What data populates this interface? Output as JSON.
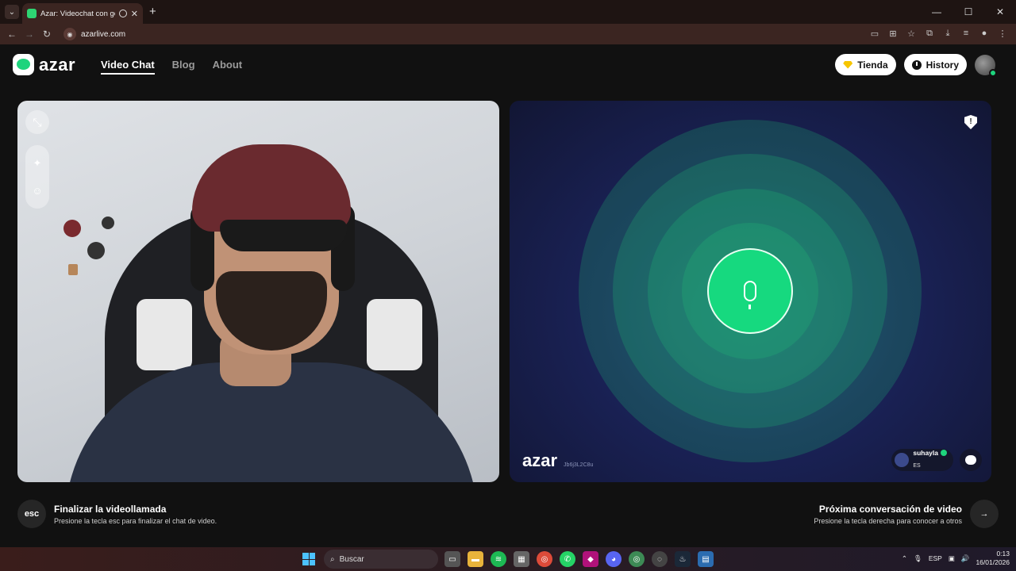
{
  "browser": {
    "tab_title": "Azar: Videochat con gente",
    "tab_close": "✕",
    "new_tab": "+",
    "url": "azarlive.com",
    "window_controls": [
      "—",
      "☐",
      "✕"
    ]
  },
  "header": {
    "logo_text": "azar",
    "nav": [
      {
        "label": "Video Chat",
        "active": true
      },
      {
        "label": "Blog",
        "active": false
      },
      {
        "label": "About",
        "active": false
      }
    ],
    "store_label": "Tienda",
    "history_label": "History"
  },
  "right_panel": {
    "watermark": "azar",
    "session_code": "Jb6j3L2C8u",
    "peer_name": "suhayla",
    "peer_country": "ES",
    "shield_glyph": "!"
  },
  "actions": {
    "end": {
      "key": "esc",
      "title": "Finalizar la videollamada",
      "subtitle": "Presione la tecla esc para finalizar el chat de video."
    },
    "next": {
      "key": "→",
      "title": "Próxima conversación de video",
      "subtitle": "Presione la tecla derecha para conocer a otros"
    }
  },
  "taskbar": {
    "search_placeholder": "Buscar",
    "language": "ESP",
    "time": "0:13",
    "date": "16/01/2026"
  },
  "colors": {
    "accent_green": "#1ed47d",
    "store_gem": "#f7c600"
  }
}
